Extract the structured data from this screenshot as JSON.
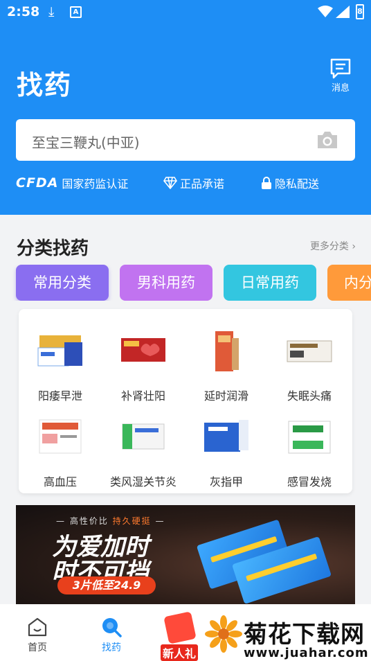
{
  "status_bar": {
    "time": "2:58",
    "download_icon": "download-icon",
    "a_badge": "A",
    "battery": "8"
  },
  "header": {
    "title": "找药",
    "message_label": "消息",
    "search": {
      "placeholder": "至宝三鞭丸(中亚)"
    },
    "badges": [
      {
        "logo": "CFDA",
        "label": "国家药监认证"
      },
      {
        "icon": "diamond-icon",
        "label": "正品承诺"
      },
      {
        "icon": "lock-icon",
        "label": "隐私配送"
      }
    ]
  },
  "categories": {
    "title": "分类找药",
    "more_label": "更多分类 ›",
    "tabs": [
      {
        "label": "常用分类",
        "color": "#8a6ef0"
      },
      {
        "label": "男科用药",
        "color": "#c173f0"
      },
      {
        "label": "日常用药",
        "color": "#33c6e0"
      },
      {
        "label": "内分",
        "color": "#ff9a3a"
      }
    ],
    "items": [
      {
        "label": "阳痿早泄"
      },
      {
        "label": "补肾壮阳"
      },
      {
        "label": "延时润滑"
      },
      {
        "label": "失眠头痛"
      },
      {
        "label": "高血压"
      },
      {
        "label": "类风湿关节炎"
      },
      {
        "label": "灰指甲"
      },
      {
        "label": "感冒发烧"
      }
    ]
  },
  "banner": {
    "tag_left": "— 高性价比 ",
    "tag_highlight": "持久硬挺",
    "tag_right": " —",
    "line1": "为爱加时",
    "line2": "时不可挡",
    "price_pill": "3片低至24.9"
  },
  "tabbar": {
    "home_label": "首页",
    "find_label": "找药",
    "promo_label": "新人礼"
  },
  "watermark": {
    "line1": "菊花下载网",
    "line2": "www.juahar.com"
  }
}
